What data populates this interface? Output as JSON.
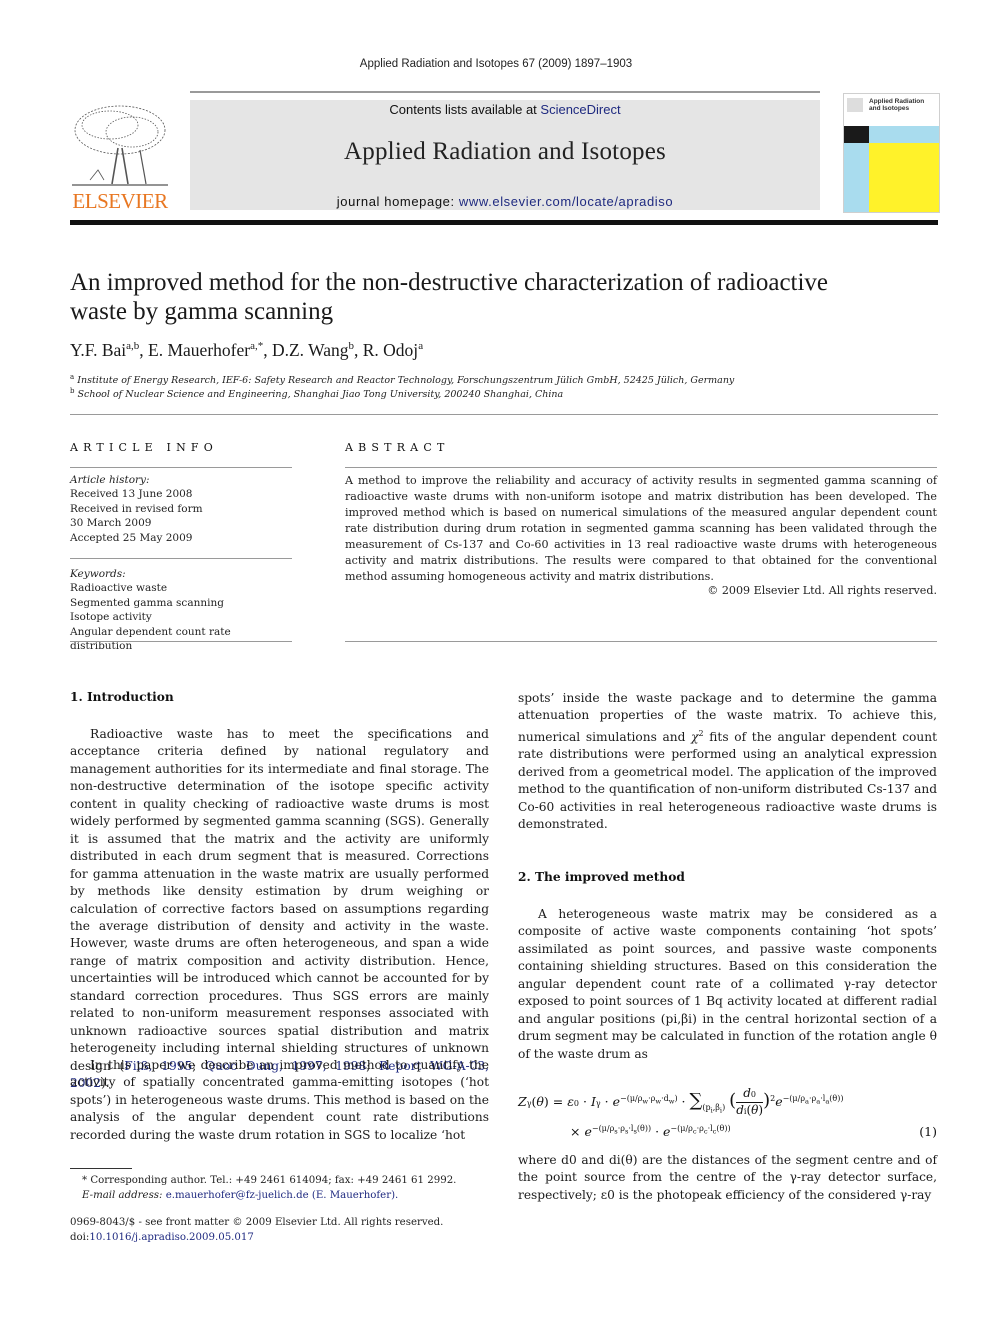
{
  "header": {
    "journal_reference": "Applied Radiation and Isotopes 67 (2009) 1897–1903",
    "contents_prefix": "Contents lists available at ",
    "contents_link": "ScienceDirect",
    "journal_title": "Applied Radiation and Isotopes",
    "homepage_prefix": "journal homepage: ",
    "homepage_link": "www.elsevier.com/locate/apradiso",
    "publisher_logo_text": "ELSEVIER",
    "cover_title": "Applied Radiation and Isotopes",
    "colors": {
      "elsevier_orange": "#e87722",
      "link_blue": "#1f2a80",
      "banner_gray": "#e5e5e5",
      "cover_yellow": "#fff22a",
      "cover_blue": "#a9dcee"
    }
  },
  "article": {
    "title_line1": "An improved method for the non-destructive characterization of radioactive",
    "title_line2": "waste by gamma scanning",
    "authors": [
      {
        "name": "Y.F. Bai",
        "sup": "a,b",
        "sep": ", "
      },
      {
        "name": "E. Mauerhofer",
        "sup": "a,*",
        "sep": ", "
      },
      {
        "name": "D.Z. Wang",
        "sup": "b",
        "sep": ", "
      },
      {
        "name": "R. Odoj",
        "sup": "a",
        "sep": ""
      }
    ],
    "affiliations": [
      {
        "mark": "a",
        "text": "Institute of Energy Research, IEF-6: Safety Research and Reactor Technology, Forschungszentrum Jülich GmbH, 52425 Jülich, Germany"
      },
      {
        "mark": "b",
        "text": "School of Nuclear Science and Engineering, Shanghai Jiao Tong University, 200240 Shanghai, China"
      }
    ]
  },
  "article_info": {
    "heading": "ARTICLE INFO",
    "history_label": "Article history:",
    "history": [
      "Received 13 June 2008",
      "Received in revised form",
      "30 March 2009",
      "Accepted 25 May 2009"
    ],
    "keywords_label": "Keywords:",
    "keywords": [
      "Radioactive waste",
      "Segmented gamma scanning",
      "Isotope activity",
      "Angular dependent count rate distribution"
    ]
  },
  "abstract": {
    "heading": "ABSTRACT",
    "text": "A method to improve the reliability and accuracy of activity results in segmented gamma scanning of radioactive waste drums with non-uniform isotope and matrix distribution has been developed. The improved method which is based on numerical simulations of the measured angular dependent count rate distribution during drum rotation in segmented gamma scanning has been validated through the measurement of Cs-137 and Co-60 activities in 13 real radioactive waste drums with heterogeneous activity and matrix distributions. The results were compared to that obtained for the conventional method assuming homogeneous activity and matrix distributions.",
    "copyright": "© 2009 Elsevier Ltd. All rights reserved."
  },
  "sections": {
    "intro_heading": "1.  Introduction",
    "intro_p1_a": "Radioactive waste has to meet the specifications and acceptance criteria defined by national regulatory and management authorities for its intermediate and final storage. The non-destructive determination of the isotope specific activity content in quality checking of radioactive waste drums is most widely performed by segmented gamma scanning (SGS). Generally it is assumed that the matrix and the activity are uniformly distributed in each drum segment that is measured. Corrections for gamma attenuation in the waste matrix are usually performed by methods like density estimation by drum weighing or calculation of corrective factors based on assumptions regarding the average distribution of density and activity in the waste. However, waste drums are often heterogeneous, and span a wide range of matrix composition and activity distribution. Hence, uncertainties will be introduced which cannot be accounted for by standard correction procedures. Thus SGS errors are mainly related to non-uniform measurement responses associated with unknown radioactive sources spatial distribution and matrix heterogeneity including internal shielding structures of unknown design (",
    "intro_refs": [
      "Filß, 1995",
      "Quoc Dung, 1997, 1998",
      "Report WG-A-03, 2002"
    ],
    "intro_p1_end": ").",
    "intro_p2": "In this paper we describe an improved method to quantify the activity of spatially concentrated gamma-emitting isotopes (‘hot spots’) in heterogeneous waste drums. This method is based on the analysis of the angular dependent count rate distributions recorded during the waste drum rotation in SGS to localize ‘hot",
    "intro_p2_cont_a": "spots’ inside the waste package and to determine the gamma attenuation properties of the waste matrix. To achieve this, numerical simulations and ",
    "chi": "χ",
    "chi_sup": "2",
    "intro_p2_cont_b": " fits of the angular dependent count rate distributions were performed using an analytical expression derived from a geometrical model. The application of the improved method to the quantification of non-uniform distributed Cs-137 and Co-60 activities in real heterogeneous radioactive waste drums is demonstrated.",
    "method_heading": "2.  The improved method",
    "method_p1": "A heterogeneous waste matrix may be considered as a composite of active waste components containing ‘hot spots’ assimilated as point sources, and passive waste components containing shielding structures. Based on this consideration the angular dependent count rate of a collimated γ-ray detector exposed to point sources of 1 Bq activity located at different radial and angular positions (pi,βi) in the central horizontal section of a drum segment may be calculated in function of the rotation angle θ of the waste drum as",
    "equation_number": "(1)",
    "method_p2": "where d0 and di(θ) are the distances of the segment centre and of the point source from the centre of the γ-ray detector surface, respectively; ε0 is the photopeak efficiency of the considered γ-ray"
  },
  "footnotes": {
    "corresponding": "* Corresponding author. Tel.: +49 2461 614094; fax: +49 2461 61 2992.",
    "email_label": "E-mail address: ",
    "email": "e.mauerhofer@fz-juelich.de (E. Mauerhofer).",
    "issn_line": "0969-8043/$ - see front matter © 2009 Elsevier Ltd. All rights reserved.",
    "doi_prefix": "doi:",
    "doi": "10.1016/j.apradiso.2009.05.017"
  }
}
